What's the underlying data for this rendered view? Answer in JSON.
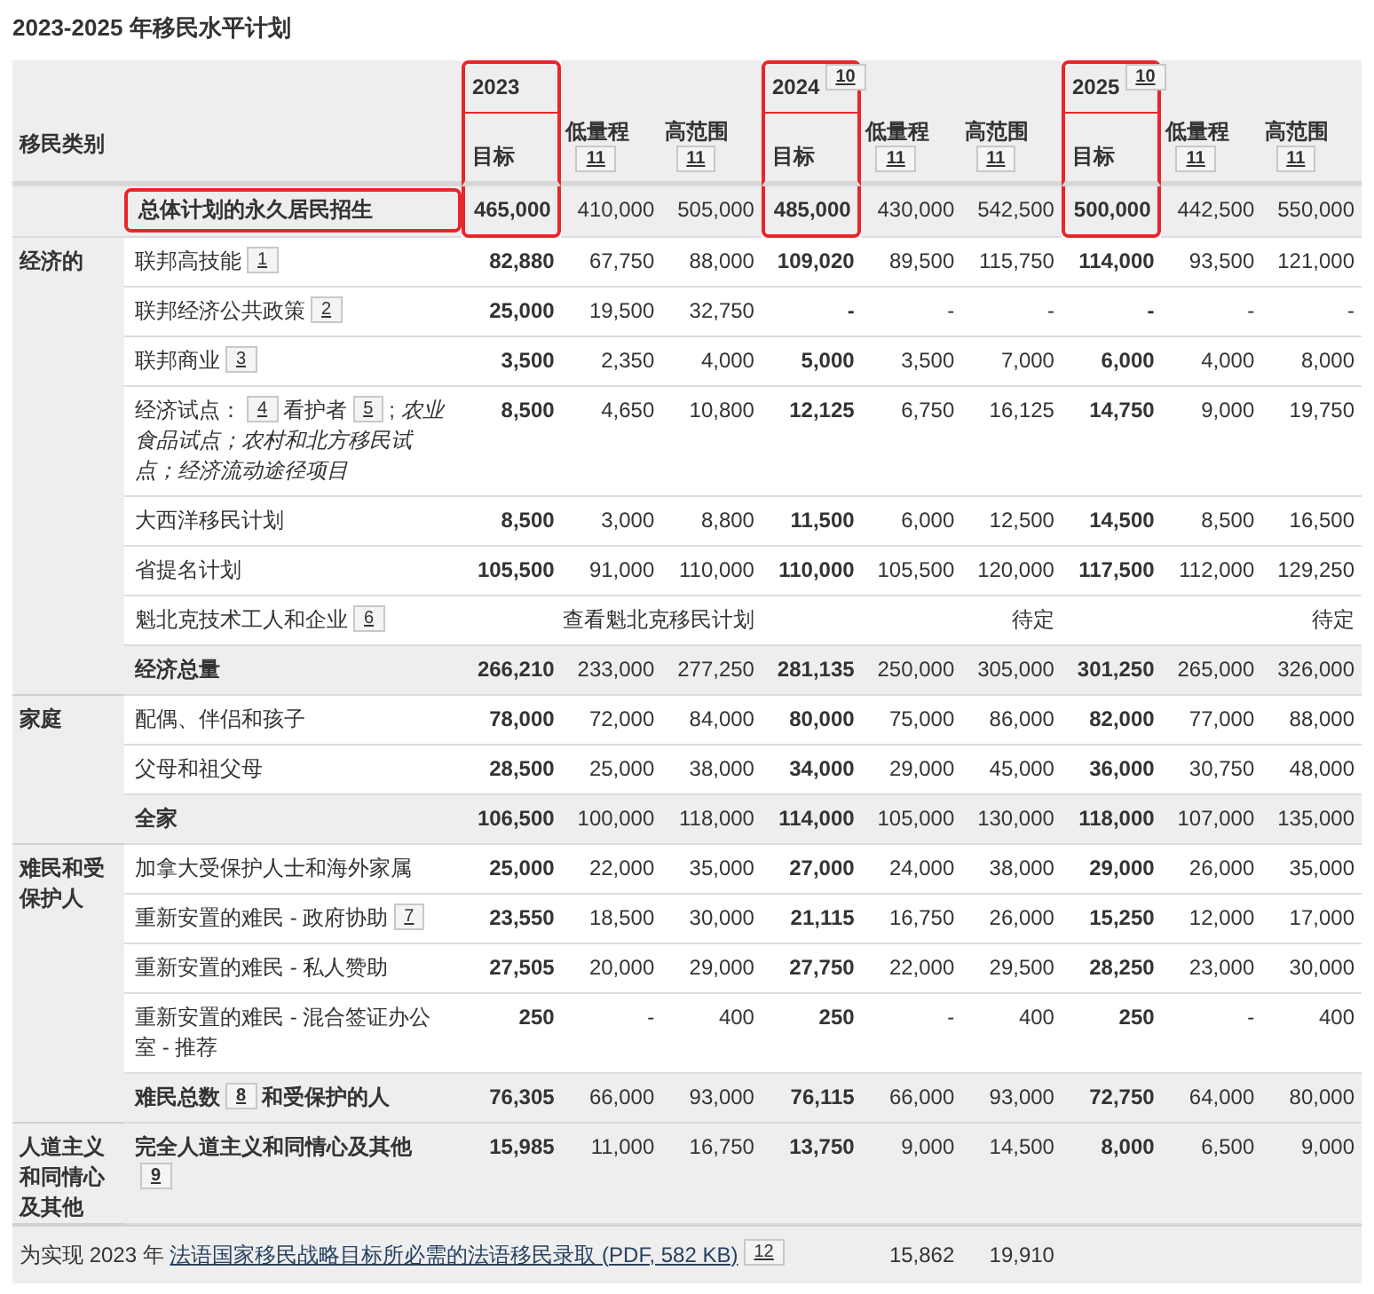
{
  "title": "2023-2025 年移民水平计划",
  "header": {
    "category_label": "移民类别",
    "years": [
      {
        "year": "2023",
        "highlighted": true,
        "target_label": "目标",
        "columns": [
          {
            "label": "低量程",
            "note": "11"
          },
          {
            "label": "高范围",
            "note": "11"
          }
        ]
      },
      {
        "year": "2024",
        "note": "10",
        "highlighted": true,
        "target_label": "目标",
        "columns": [
          {
            "label": "低量程",
            "note": "11"
          },
          {
            "label": "高范围",
            "note": "11"
          }
        ]
      },
      {
        "year": "2025",
        "note": "10",
        "highlighted": true,
        "target_label": "目标",
        "columns": [
          {
            "label": "低量程",
            "note": "11"
          },
          {
            "label": "高范围",
            "note": "11"
          }
        ]
      }
    ]
  },
  "total_row": {
    "label": "总体计划的永久居民招生",
    "highlighted": true,
    "values": [
      "465,000",
      "410,000",
      "505,000",
      "485,000",
      "430,000",
      "542,500",
      "500,000",
      "442,500",
      "550,000"
    ]
  },
  "groups": [
    {
      "category": "经济的",
      "rows": [
        {
          "kind": "item",
          "label": [
            {
              "text": "联邦高技能"
            },
            {
              "note": "1"
            }
          ],
          "values": [
            "82,880",
            "67,750",
            "88,000",
            "109,020",
            "89,500",
            "115,750",
            "114,000",
            "93,500",
            "121,000"
          ]
        },
        {
          "kind": "item",
          "label": [
            {
              "text": "联邦经济公共政策"
            },
            {
              "note": "2"
            }
          ],
          "values": [
            "25,000",
            "19,500",
            "32,750",
            "-",
            "-",
            "-",
            "-",
            "-",
            "-"
          ]
        },
        {
          "kind": "item",
          "label": [
            {
              "text": "联邦商业"
            },
            {
              "note": "3"
            }
          ],
          "values": [
            "3,500",
            "2,350",
            "4,000",
            "5,000",
            "3,500",
            "7,000",
            "6,000",
            "4,000",
            "8,000"
          ]
        },
        {
          "kind": "item",
          "label": [
            {
              "text": "经济试点："
            },
            {
              "note": "4"
            },
            {
              "text": "看护者"
            },
            {
              "note": "5"
            },
            {
              "text": "; *农业食品试点；农村和北方移民试点；经济流动途径项目*"
            }
          ],
          "values": [
            "8,500",
            "4,650",
            "10,800",
            "12,125",
            "6,750",
            "16,125",
            "14,750",
            "9,000",
            "19,750"
          ]
        },
        {
          "kind": "item",
          "label": [
            {
              "text": "大西洋移民计划"
            }
          ],
          "values": [
            "8,500",
            "3,000",
            "8,800",
            "11,500",
            "6,000",
            "12,500",
            "14,500",
            "8,500",
            "16,500"
          ]
        },
        {
          "kind": "item",
          "label": [
            {
              "text": "省提名计划"
            }
          ],
          "values": [
            "105,500",
            "91,000",
            "110,000",
            "110,000",
            "105,500",
            "120,000",
            "117,500",
            "112,000",
            "129,250"
          ]
        },
        {
          "kind": "merged",
          "label": [
            {
              "text": "魁北克技术工人和企业"
            },
            {
              "note": "6"
            }
          ],
          "values": [
            "查看魁北克移民计划",
            "待定",
            "待定"
          ]
        },
        {
          "kind": "subtotal",
          "label": [
            {
              "text": "经济总量"
            }
          ],
          "values": [
            "266,210",
            "233,000",
            "277,250",
            "281,135",
            "250,000",
            "305,000",
            "301,250",
            "265,000",
            "326,000"
          ]
        }
      ]
    },
    {
      "category": "家庭",
      "rows": [
        {
          "kind": "item",
          "label": [
            {
              "text": "配偶、伴侣和孩子"
            }
          ],
          "values": [
            "78,000",
            "72,000",
            "84,000",
            "80,000",
            "75,000",
            "86,000",
            "82,000",
            "77,000",
            "88,000"
          ]
        },
        {
          "kind": "item",
          "label": [
            {
              "text": "父母和祖父母"
            }
          ],
          "values": [
            "28,500",
            "25,000",
            "38,000",
            "34,000",
            "29,000",
            "45,000",
            "36,000",
            "30,750",
            "48,000"
          ]
        },
        {
          "kind": "subtotal",
          "label": [
            {
              "text": "全家"
            }
          ],
          "values": [
            "106,500",
            "100,000",
            "118,000",
            "114,000",
            "105,000",
            "130,000",
            "118,000",
            "107,000",
            "135,000"
          ]
        }
      ]
    },
    {
      "category": "难民和受保护人",
      "rows": [
        {
          "kind": "item",
          "label": [
            {
              "text": "加拿大受保护人士和海外家属"
            }
          ],
          "values": [
            "25,000",
            "22,000",
            "35,000",
            "27,000",
            "24,000",
            "38,000",
            "29,000",
            "26,000",
            "35,000"
          ]
        },
        {
          "kind": "item",
          "label": [
            {
              "text": "重新安置的难民 - 政府协助"
            },
            {
              "note": "7"
            }
          ],
          "values": [
            "23,550",
            "18,500",
            "30,000",
            "21,115",
            "16,750",
            "26,000",
            "15,250",
            "12,000",
            "17,000"
          ]
        },
        {
          "kind": "item",
          "label": [
            {
              "text": "重新安置的难民 - 私人赞助"
            }
          ],
          "values": [
            "27,505",
            "20,000",
            "29,000",
            "27,750",
            "22,000",
            "29,500",
            "28,250",
            "23,000",
            "30,000"
          ]
        },
        {
          "kind": "item",
          "label": [
            {
              "text": "重新安置的难民 - 混合签证办公室 - 推荐"
            }
          ],
          "values": [
            "250",
            "-",
            "400",
            "250",
            "-",
            "400",
            "250",
            "-",
            "400"
          ]
        },
        {
          "kind": "subtotal",
          "label": [
            {
              "text": "难民总数"
            },
            {
              "note": "8"
            },
            {
              "text": "和受保护的人"
            }
          ],
          "values": [
            "76,305",
            "66,000",
            "93,000",
            "76,115",
            "66,000",
            "93,000",
            "72,750",
            "64,000",
            "80,000"
          ]
        }
      ]
    },
    {
      "category": "人道主义和同情心及其他",
      "rows": [
        {
          "kind": "subtotal",
          "label": [
            {
              "text": "完全人道主义和同情心及其他"
            },
            {
              "note": "9"
            }
          ],
          "values": [
            "15,985",
            "11,000",
            "16,750",
            "13,750",
            "9,000",
            "14,500",
            "8,000",
            "6,500",
            "9,000"
          ]
        }
      ]
    }
  ],
  "footer": {
    "prefix": "为实现 2023 年",
    "link": "法语国家移民战略目标所必需的法语移民录取 (PDF, 582 KB)",
    "note": "12",
    "values": [
      "15,862",
      "19,910"
    ]
  }
}
